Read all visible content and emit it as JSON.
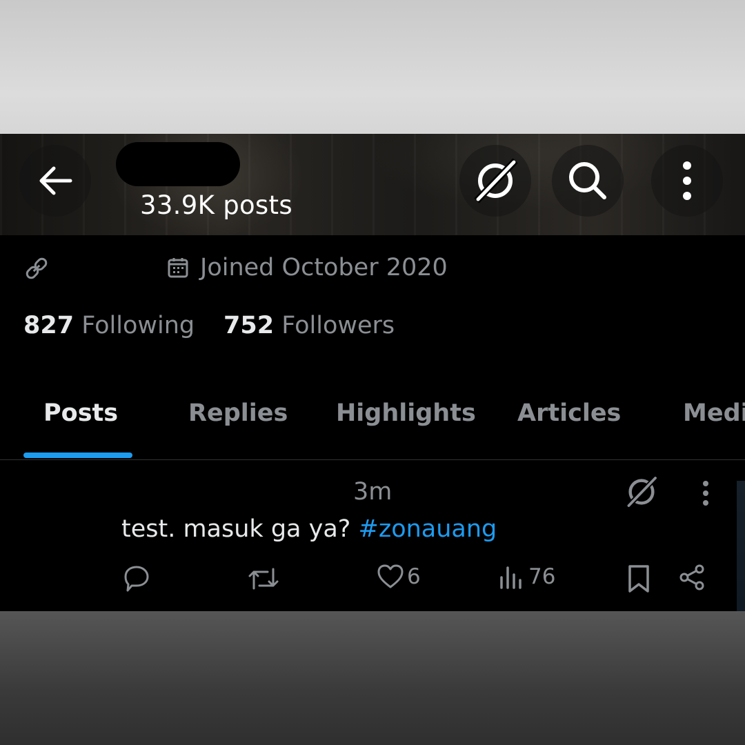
{
  "header": {
    "back_icon": "arrow-left-icon",
    "grok_icon": "grok-icon",
    "search_icon": "search-icon",
    "more_icon": "more-vertical-icon",
    "posts_count": "33.9K posts"
  },
  "profile": {
    "link_icon": "link-icon",
    "calendar_icon": "calendar-icon",
    "joined": "Joined October 2020",
    "following_count": "827",
    "following_label": "Following",
    "followers_count": "752",
    "followers_label": "Followers"
  },
  "tabs": [
    {
      "label": "Posts",
      "active": true
    },
    {
      "label": "Replies",
      "active": false
    },
    {
      "label": "Highlights",
      "active": false
    },
    {
      "label": "Articles",
      "active": false
    },
    {
      "label": "Medi",
      "active": false
    }
  ],
  "post": {
    "time": "3m",
    "text": "test. masuk ga ya?",
    "hashtag": "#zonauang",
    "likes": "6",
    "views": "76"
  },
  "colors": {
    "accent": "#1d9bf0",
    "text_primary": "#e7e9ea",
    "text_secondary": "#8b8f93",
    "background": "#000000"
  }
}
